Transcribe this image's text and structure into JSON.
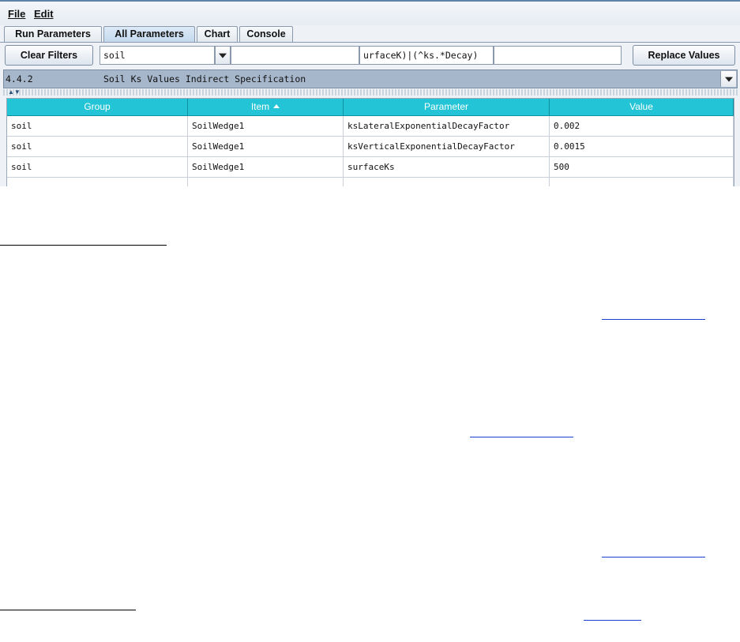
{
  "menu": {
    "file": "File",
    "edit": "Edit"
  },
  "tabs": [
    "Run Parameters",
    "All Parameters",
    "Chart",
    "Console"
  ],
  "toolbar": {
    "clear_filters": "Clear Filters",
    "group_filter": "soil",
    "item_filter": "",
    "param_filter": "urfaceK)|(^ks.*Decay)",
    "value_field": "",
    "replace_values": "Replace Values"
  },
  "section": {
    "number": "4.4.2",
    "title": "Soil Ks Values Indirect Specification"
  },
  "table": {
    "columns": [
      "Group",
      "Item",
      "Parameter",
      "Value"
    ],
    "rows": [
      [
        "soil",
        "SoilWedge1",
        "ksLateralExponentialDecayFactor",
        "0.002"
      ],
      [
        "soil",
        "SoilWedge1",
        "ksVerticalExponentialDecayFactor",
        "0.0015"
      ],
      [
        "soil",
        "SoilWedge1",
        "surfaceKs",
        "500"
      ],
      [
        "",
        "",
        "",
        ""
      ]
    ]
  },
  "colors": {
    "header": "#22c4d6",
    "section": "#a6b7cb",
    "active_tab": "#c4d9ee",
    "link": "#1d3fd0"
  }
}
